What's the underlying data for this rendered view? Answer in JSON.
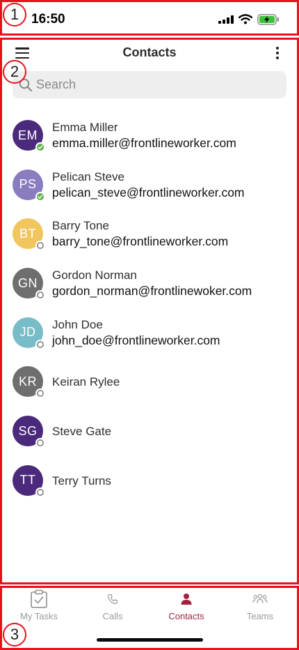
{
  "status_bar": {
    "time": "16:50"
  },
  "header": {
    "title": "Contacts"
  },
  "search": {
    "placeholder": "Search"
  },
  "contacts": [
    {
      "initials": "EM",
      "name": "Emma Miller",
      "email": "emma.miller@frontlineworker.com",
      "avatar_color": "#4b2a7b",
      "presence": "online"
    },
    {
      "initials": "PS",
      "name": "Pelican Steve",
      "email": "pelican_steve@frontlineworker.com",
      "avatar_color": "#8a7cbf",
      "presence": "online"
    },
    {
      "initials": "BT",
      "name": "Barry Tone",
      "email": "barry_tone@frontlineworker.com",
      "avatar_color": "#f1c65e",
      "presence": "offline"
    },
    {
      "initials": "GN",
      "name": "Gordon Norman",
      "email": "gordon_norman@frontlinewoker.com",
      "avatar_color": "#6e6e6e",
      "presence": "offline"
    },
    {
      "initials": "JD",
      "name": "John Doe",
      "email": "john_doe@frontlineworker.com",
      "avatar_color": "#78bcc8",
      "presence": "offline"
    },
    {
      "initials": "KR",
      "name": "Keiran Rylee",
      "email": "",
      "avatar_color": "#6e6e6e",
      "presence": "offline"
    },
    {
      "initials": "SG",
      "name": "Steve Gate",
      "email": "",
      "avatar_color": "#4b2a7b",
      "presence": "offline"
    },
    {
      "initials": "TT",
      "name": "Terry Turns",
      "email": "",
      "avatar_color": "#4b2a7b",
      "presence": "offline"
    }
  ],
  "tabs": [
    {
      "label": "My Tasks",
      "icon": "clipboard-check-icon",
      "active": false
    },
    {
      "label": "Calls",
      "icon": "phone-icon",
      "active": false
    },
    {
      "label": "Contacts",
      "icon": "person-icon",
      "active": true
    },
    {
      "label": "Teams",
      "icon": "people-group-icon",
      "active": false
    }
  ],
  "annotations": [
    "1",
    "2",
    "3"
  ],
  "colors": {
    "accent": "#a0223e",
    "online": "#5fae4c",
    "annotation": "#e8101c"
  }
}
